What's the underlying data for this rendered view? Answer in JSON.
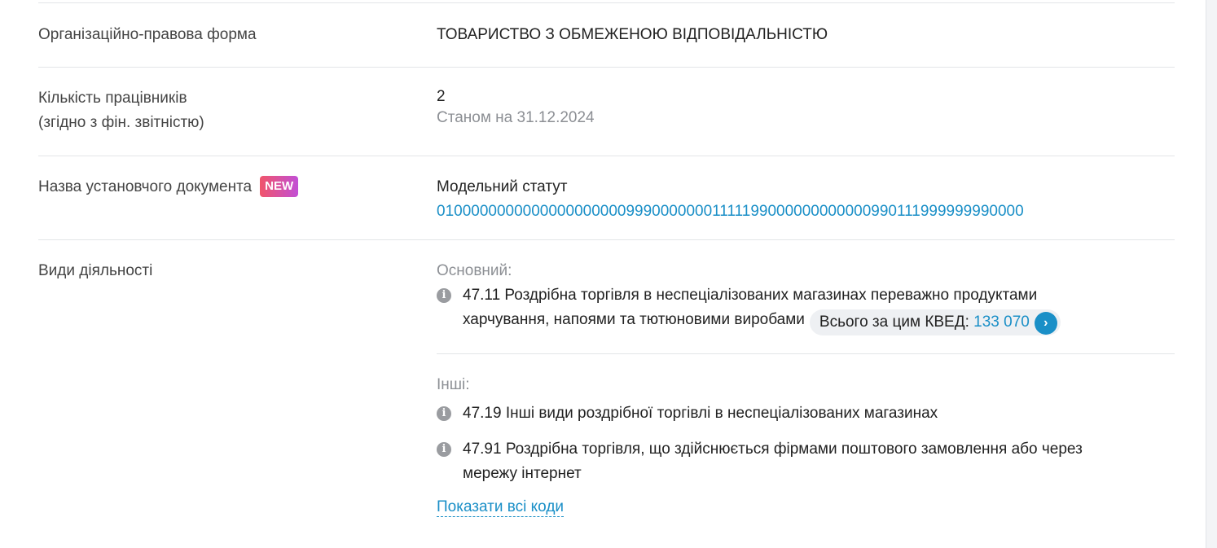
{
  "rows": {
    "legal_form": {
      "label": "Організаційно-правова форма",
      "value": "ТОВАРИСТВО З ОБМЕЖЕНОЮ ВІДПОВІДАЛЬНІСТЮ"
    },
    "employees": {
      "label_line1": "Кількість працівників",
      "label_line2": "(згідно з фін. звітністю)",
      "value": "2",
      "as_of": "Станом на 31.12.2024"
    },
    "founding_doc": {
      "label": "Назва установчого документа",
      "badge": "NEW",
      "value": "Модельний статут",
      "code": "010000000000000000000099900000001111199000000000000990111999999990000"
    },
    "activities": {
      "label": "Види діяльності",
      "main_heading": "Основний:",
      "main_item_line1": "47.11 Роздрібна торгівля в неспеціалізованих магазинах переважно продуктами",
      "main_item_line2": "харчування, напоями та тютюновими виробами",
      "total_label": "Всього за цим КВЕД:",
      "total_value": "133 070",
      "other_heading": "Інші:",
      "other_items": [
        {
          "text": "47.19 Інші види роздрібної торгівлі в неспеціалізованих магазинах"
        },
        {
          "line1": "47.91 Роздрібна торгівля, що здійснюється фірмами поштового замовлення або через",
          "line2": "мережу інтернет"
        }
      ],
      "show_all": "Показати всі коди"
    }
  },
  "icons": {
    "info": "info-icon",
    "chevron": "chevron-right-icon"
  },
  "colors": {
    "link": "#1a8fc7",
    "muted": "#8c8f94",
    "badge_gradient_start": "#f0556b",
    "badge_gradient_end": "#c24fd6"
  }
}
